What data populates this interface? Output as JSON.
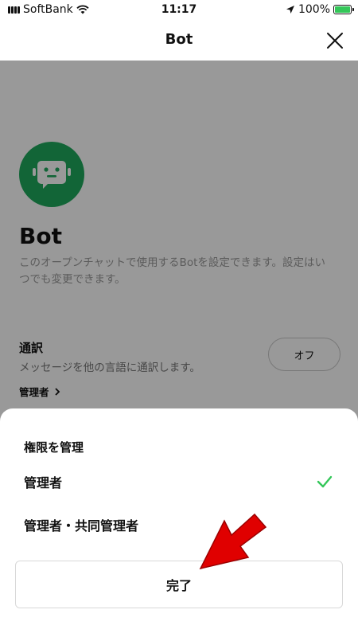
{
  "status_bar": {
    "carrier": "SoftBank",
    "time": "11:17",
    "battery": "100%",
    "battery_level_pct": 100
  },
  "nav": {
    "title": "Bot"
  },
  "content": {
    "heading": "Bot",
    "description": "このオープンチャットで使用するBotを設定できます。設定はいつでも変更できます。",
    "setting": {
      "title": "通訳",
      "description": "メッセージを他の言語に通訳します。",
      "role": "管理者",
      "toggle_label": "オフ"
    }
  },
  "sheet": {
    "title": "権限を管理",
    "options": [
      {
        "label": "管理者",
        "selected": true
      },
      {
        "label": "管理者・共同管理者",
        "selected": false
      }
    ],
    "done_label": "完了"
  },
  "colors": {
    "accent_green": "#1fa85c",
    "check_green": "#34c759",
    "annotation_red": "#e00000"
  }
}
